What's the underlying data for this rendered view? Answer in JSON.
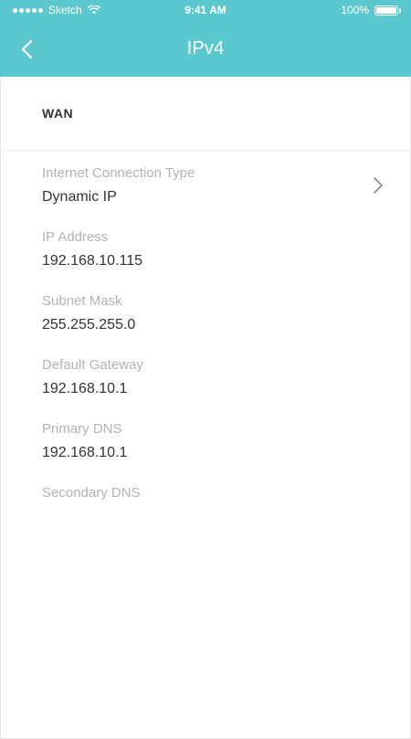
{
  "status_bar": {
    "carrier": "Sketch",
    "time": "9:41 AM",
    "battery": "100%"
  },
  "nav": {
    "title": "IPv4",
    "back_icon": "chevron-left-icon"
  },
  "section": {
    "title": "WAN"
  },
  "fields": [
    {
      "label": "Internet Connection Type",
      "value": "Dynamic IP",
      "has_chevron": true
    },
    {
      "label": "IP Address",
      "value": "192.168.10.115"
    },
    {
      "label": "Subnet Mask",
      "value": "255.255.255.0"
    },
    {
      "label": "Default Gateway",
      "value": "192.168.10.1"
    },
    {
      "label": "Primary DNS",
      "value": "192.168.10.1"
    },
    {
      "label": "Secondary DNS",
      "value": ""
    }
  ],
  "colors": {
    "accent": "#5bc8d0",
    "label": "#b3b3b3",
    "value": "#333333"
  }
}
